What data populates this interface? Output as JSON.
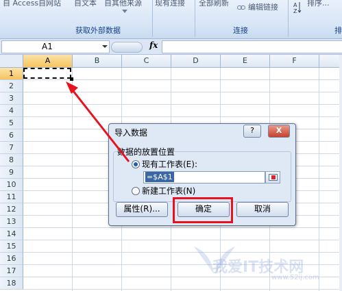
{
  "ribbon": {
    "top_items": [
      "自 Access",
      "自网站",
      "自文本",
      "自其他来源",
      "现有连接",
      "全部刷新",
      "编辑链接",
      "排序..."
    ],
    "groups": {
      "external": "获取外部数据",
      "connections": "连接",
      "sort_partial": "排"
    }
  },
  "formula_bar": {
    "name_box": "A1",
    "fx_label": "fx",
    "formula": ""
  },
  "grid": {
    "columns": [
      "A",
      "B",
      "C",
      "D",
      "E",
      "F"
    ],
    "rows": [
      "1",
      "2",
      "3",
      "4",
      "5",
      "6",
      "7",
      "8",
      "9",
      "10",
      "11",
      "12",
      "13",
      "14",
      "15",
      "16",
      "17",
      "18"
    ],
    "active_cell": "A1"
  },
  "dialog": {
    "title": "导入数据",
    "help_glyph": "?",
    "close_glyph": "X",
    "group_label": "数据的放置位置",
    "option_existing": "现有工作表(E):",
    "option_new": "新建工作表(N)",
    "reference": "=$A$1",
    "btn_properties": "属性(R)...",
    "btn_ok": "确定",
    "btn_cancel": "取消"
  },
  "watermark": {
    "main": "我爱IT技术网",
    "sub": "www.52ij.com"
  },
  "colors": {
    "accent_red": "#e8121e",
    "header_active": "#f6c45f",
    "ribbon_blue": "#d6e4f5"
  }
}
